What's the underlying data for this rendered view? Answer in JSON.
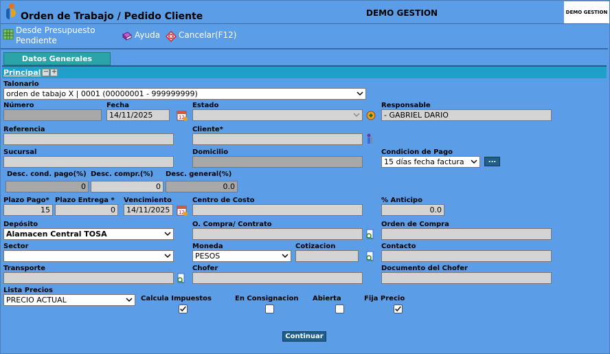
{
  "header": {
    "title": "Orden de Trabajo / Pedido Cliente",
    "company": "DEMO GESTION",
    "brand_text": "DEMO GESTION"
  },
  "toolbar": {
    "from_budget_line1": "Desde Presupuesto",
    "from_budget_line2": "Pendiente",
    "help": "Ayuda",
    "cancel": "Cancelar(F12)"
  },
  "tabs": {
    "general": "Datos Generales"
  },
  "section": {
    "principal": "Principal"
  },
  "form": {
    "talonario_label": "Talonario",
    "talonario_value": "orden de tabajo X | 0001 (00000001 - 999999999)",
    "numero_label": "Número",
    "numero_value": "",
    "fecha_label": "Fecha",
    "fecha_value": "14/11/2025",
    "estado_label": "Estado",
    "estado_value": "",
    "responsable_label": "Responsable",
    "responsable_value": "- GABRIEL DARIO",
    "referencia_label": "Referencia",
    "referencia_value": "",
    "cliente_label": "Cliente*",
    "cliente_value": "",
    "sucursal_label": "Sucursal",
    "sucursal_value": "",
    "domicilio_label": "Domicilio",
    "domicilio_value": "",
    "condicion_label": "Condicion de Pago",
    "condicion_value": "15 días fecha factura",
    "condicion_more": "...",
    "desc_cond_label": "Desc. cond. pago(%)",
    "desc_cond_value": "0",
    "desc_compr_label": "Desc. compr.(%)",
    "desc_compr_value": "0",
    "desc_general_label": "Desc. general(%)",
    "desc_general_value": "0.0",
    "plazo_pago_label": "Plazo Pago*",
    "plazo_pago_value": "15",
    "plazo_entrega_label": "Plazo Entrega *",
    "plazo_entrega_value": "0",
    "vencimiento_label": "Vencimiento",
    "vencimiento_value": "14/11/2025",
    "centro_costo_label": "Centro de Costo",
    "centro_costo_value": "",
    "anticipo_label": "% Anticipo",
    "anticipo_value": "0.0",
    "deposito_label": "Depósito",
    "deposito_value": "Alamacen Central TOSA",
    "ocompra_label": "O. Compra/ Contrato",
    "ocompra_value": "",
    "orden_compra_label": "Orden de Compra",
    "orden_compra_value": "",
    "sector_label": "Sector",
    "sector_value": "",
    "moneda_label": "Moneda",
    "moneda_value": "PESOS",
    "cotizacion_label": "Cotizacion",
    "cotizacion_value": "",
    "contacto_label": "Contacto",
    "contacto_value": "",
    "transporte_label": "Transporte",
    "transporte_value": "",
    "chofer_label": "Chofer",
    "chofer_value": "",
    "doc_chofer_label": "Documento del Chofer",
    "doc_chofer_value": "",
    "lista_precios_label": "Lista Precios",
    "lista_precios_value": "PRECIO ACTUAL",
    "calcula_impuestos_label": "Calcula Impuestos",
    "calcula_impuestos_checked": true,
    "consignacion_label": "En Consignacion",
    "consignacion_checked": false,
    "abierta_label": "Abierta",
    "abierta_checked": false,
    "fija_precio_label": "Fija Precio",
    "fija_precio_checked": true
  },
  "actions": {
    "continue": "Continuar"
  }
}
